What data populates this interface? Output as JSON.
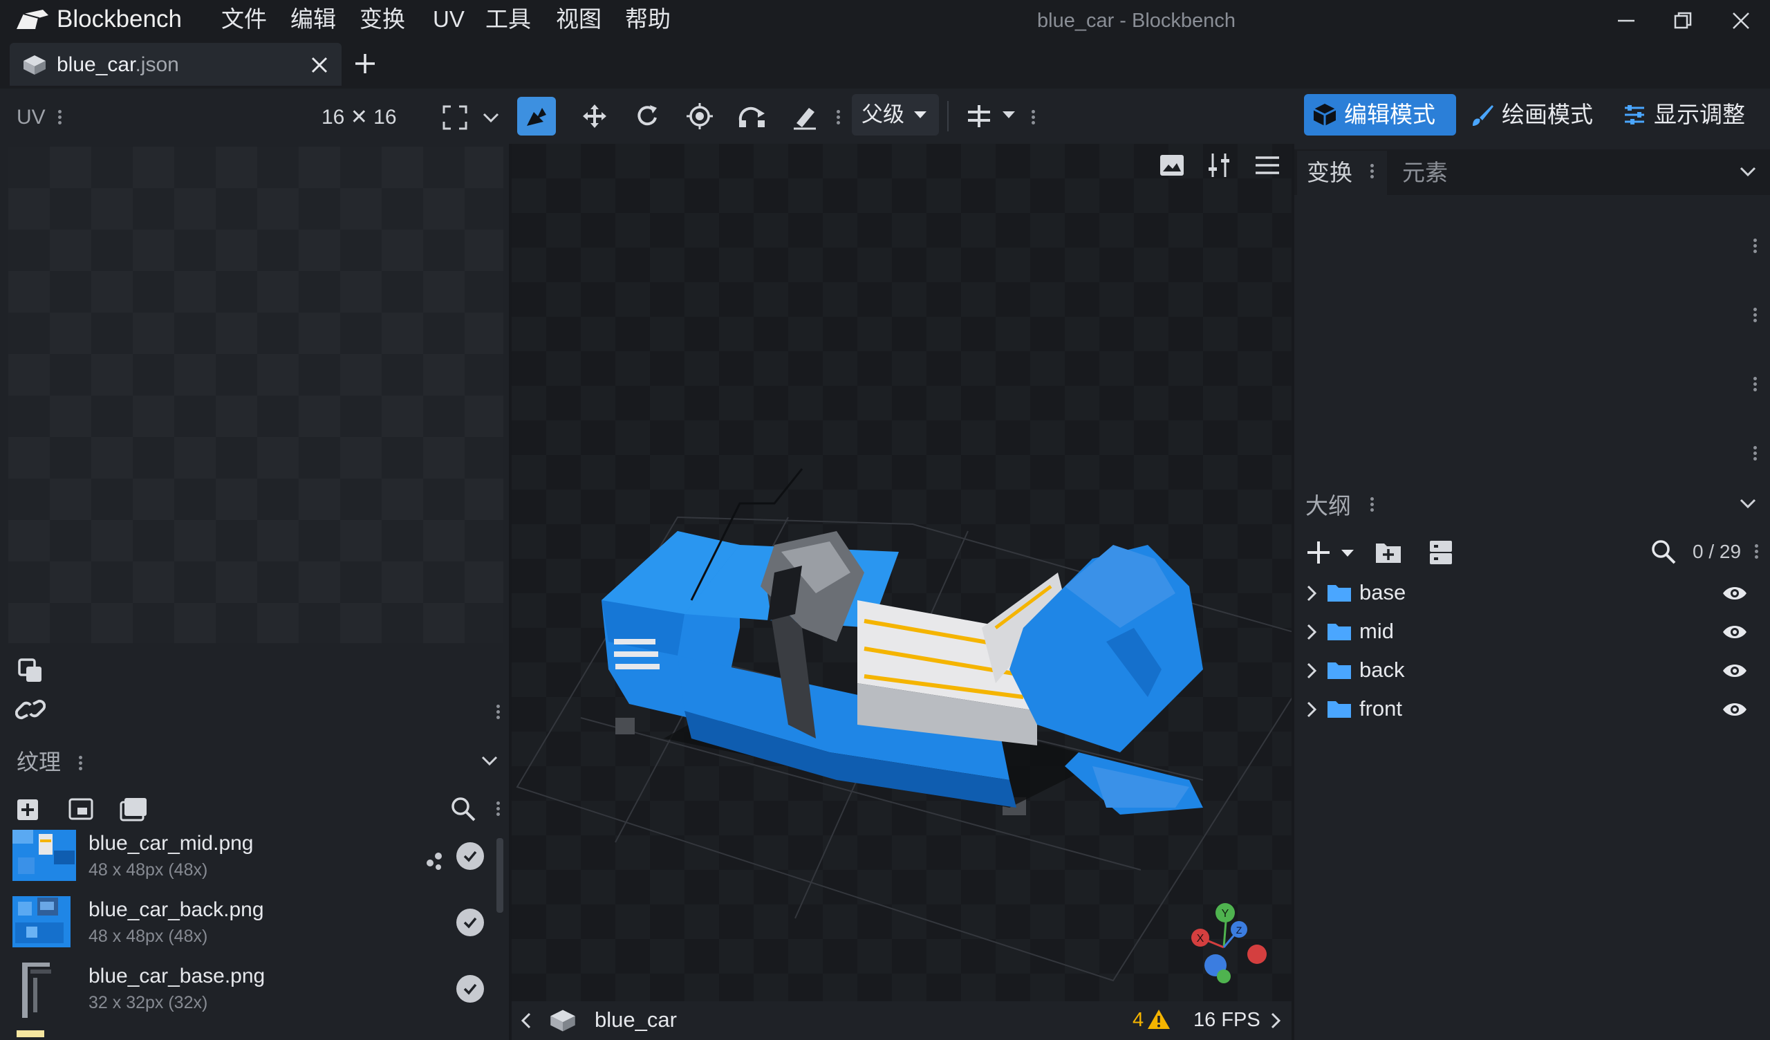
{
  "app": {
    "name": "Blockbench",
    "window_title": "blue_car - Blockbench"
  },
  "menu": [
    {
      "label": "文件"
    },
    {
      "label": "编辑"
    },
    {
      "label": "变换"
    },
    {
      "label": "UV"
    },
    {
      "label": "工具"
    },
    {
      "label": "视图"
    },
    {
      "label": "帮助"
    }
  ],
  "tab": {
    "name": "blue_car",
    "ext": ".json"
  },
  "toolbar": {
    "uv_label": "UV",
    "uv_size": "16 ✕ 16",
    "pivot_select": "父级",
    "modes": {
      "edit": "编辑模式",
      "paint": "绘画模式",
      "display": "显示调整"
    },
    "active_mode": "edit",
    "active_tool": "move-scale-tool"
  },
  "textures": {
    "title": "纹理",
    "items": [
      {
        "name": "blue_car_mid.png",
        "size": "48 x 48px (48x)"
      },
      {
        "name": "blue_car_back.png",
        "size": "48 x 48px (48x)"
      },
      {
        "name": "blue_car_base.png",
        "size": "32 x 32px (32x)"
      }
    ]
  },
  "viewport": {
    "model_name": "blue_car",
    "warnings": "4",
    "fps": "16 FPS",
    "axes": {
      "x": "X",
      "y": "Y",
      "z": "Z"
    }
  },
  "right_panel": {
    "tabs": {
      "transform": "变换",
      "element": "元素"
    },
    "outliner": {
      "title": "大纲",
      "count": "0 / 29",
      "groups": [
        {
          "name": "base"
        },
        {
          "name": "mid"
        },
        {
          "name": "back"
        },
        {
          "name": "front"
        }
      ]
    }
  },
  "colors": {
    "accent": "#2b7fd8",
    "car_blue": "#1f86e6",
    "warning": "#f5b400",
    "folder": "#4aa6ff"
  }
}
